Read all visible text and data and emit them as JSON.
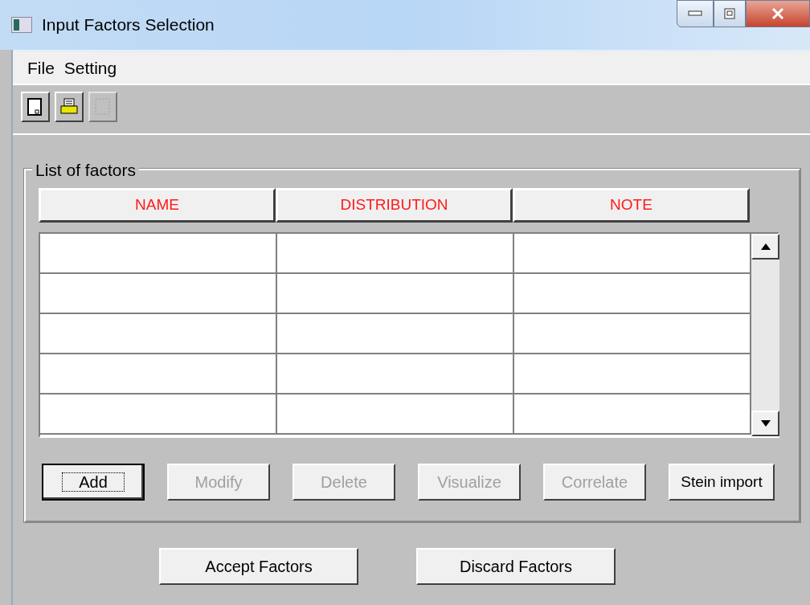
{
  "window": {
    "title": "Input Factors Selection"
  },
  "menu": [
    "File",
    "Setting"
  ],
  "toolbar": [
    {
      "kind": "page",
      "disabled": false
    },
    {
      "kind": "printer",
      "disabled": false
    },
    {
      "kind": "select",
      "disabled": true
    }
  ],
  "factors": {
    "title": "List of factors",
    "columns": [
      "NAME",
      "DISTRIBUTION",
      "NOTE"
    ]
  },
  "factor_buttons": [
    {
      "label": "Add",
      "disabled": false,
      "focused": true
    },
    {
      "label": "Modify",
      "disabled": true,
      "focused": false
    },
    {
      "label": "Delete",
      "disabled": true,
      "focused": false
    },
    {
      "label": "Visualize",
      "disabled": true,
      "focused": false
    },
    {
      "label": "Correlate",
      "disabled": true,
      "focused": false
    },
    {
      "label": "Stein import",
      "disabled": false,
      "focused": false
    }
  ],
  "dialog_buttons": [
    "Accept Factors",
    "Discard Factors"
  ]
}
